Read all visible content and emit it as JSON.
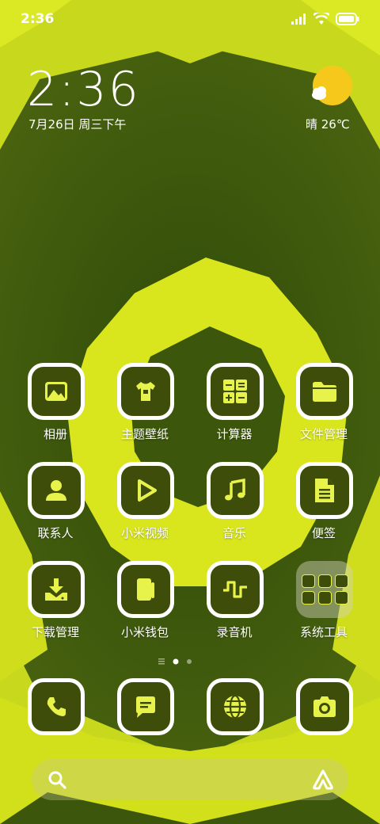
{
  "status_bar": {
    "time": "2:36",
    "icons": [
      "signal-icon",
      "wifi-icon",
      "battery-icon"
    ]
  },
  "clock_widget": {
    "time": "2:36",
    "date": "7月26日 周三下午"
  },
  "weather_widget": {
    "icon": "sunny-cloud-icon",
    "text": "晴 26℃"
  },
  "apps": [
    {
      "label": "相册",
      "icon": "gallery-icon"
    },
    {
      "label": "主题壁纸",
      "icon": "tshirt-icon"
    },
    {
      "label": "计算器",
      "icon": "calculator-icon"
    },
    {
      "label": "文件管理",
      "icon": "folder-icon"
    },
    {
      "label": "联系人",
      "icon": "contact-icon"
    },
    {
      "label": "小米视频",
      "icon": "play-icon"
    },
    {
      "label": "音乐",
      "icon": "music-note-icon"
    },
    {
      "label": "便签",
      "icon": "note-icon"
    },
    {
      "label": "下载管理",
      "icon": "download-icon"
    },
    {
      "label": "小米钱包",
      "icon": "wallet-icon"
    },
    {
      "label": "录音机",
      "icon": "waveform-icon"
    },
    {
      "label": "系统工具",
      "icon": "folder-group-icon"
    }
  ],
  "page_indicator": {
    "pages": 2,
    "current": 1
  },
  "dock": [
    {
      "icon": "phone-icon"
    },
    {
      "icon": "message-icon"
    },
    {
      "icon": "browser-icon"
    },
    {
      "icon": "camera-icon"
    }
  ],
  "search_bar": {
    "left_icon": "search-icon",
    "right_icon": "assistant-icon"
  },
  "colors": {
    "accent_yellow": "#e7f24a",
    "tile_bg": "#3f4d0b",
    "wallpaper_green": "#3f5a0c"
  }
}
